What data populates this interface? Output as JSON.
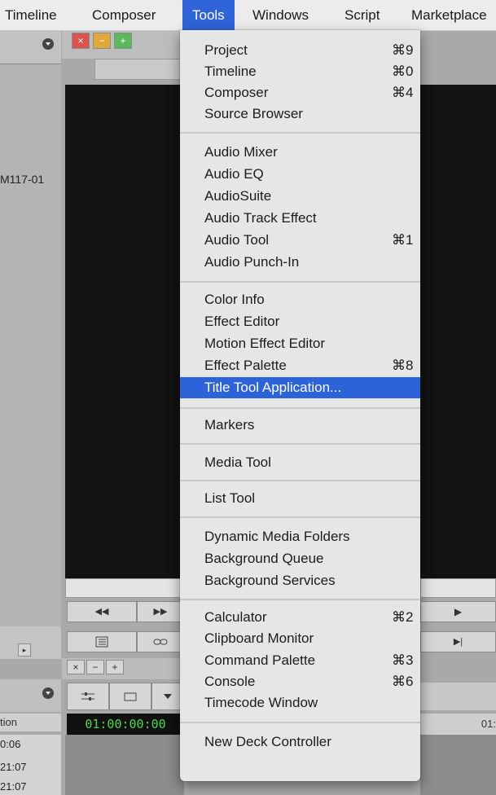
{
  "menubar": {
    "items": [
      {
        "label": "Timeline"
      },
      {
        "label": "Composer"
      },
      {
        "label": "Tools"
      },
      {
        "label": "Windows"
      },
      {
        "label": "Script"
      },
      {
        "label": "Marketplace"
      }
    ]
  },
  "background": {
    "bin_clip_name": "M117-01",
    "window_controls": {
      "close": "×",
      "minimize": "−",
      "zoom": "+"
    },
    "transport_rewind": "◀◀",
    "transport_forward": "▶▶",
    "transport_play": "▶",
    "transport_mark_out": "▶|",
    "timeline_column_label": "tion",
    "timecode": "01:00:00:00",
    "timecode_right": "01:",
    "row_times": [
      "0:06",
      "21:07",
      "21:07"
    ]
  },
  "menu": {
    "items": [
      {
        "label": "Project",
        "shortcut": "⌘9"
      },
      {
        "label": "Timeline",
        "shortcut": "⌘0"
      },
      {
        "label": "Composer",
        "shortcut": "⌘4"
      },
      {
        "label": "Source Browser",
        "shortcut": ""
      },
      {
        "label": "Audio Mixer",
        "shortcut": ""
      },
      {
        "label": "Audio EQ",
        "shortcut": ""
      },
      {
        "label": "AudioSuite",
        "shortcut": ""
      },
      {
        "label": "Audio Track Effect",
        "shortcut": ""
      },
      {
        "label": "Audio Tool",
        "shortcut": "⌘1"
      },
      {
        "label": "Audio Punch-In",
        "shortcut": ""
      },
      {
        "label": "Color Info",
        "shortcut": ""
      },
      {
        "label": "Effect Editor",
        "shortcut": ""
      },
      {
        "label": "Motion Effect Editor",
        "shortcut": ""
      },
      {
        "label": "Effect Palette",
        "shortcut": "⌘8"
      },
      {
        "label": "Title Tool Application...",
        "shortcut": ""
      },
      {
        "label": "Markers",
        "shortcut": ""
      },
      {
        "label": "Media Tool",
        "shortcut": ""
      },
      {
        "label": "List Tool",
        "shortcut": ""
      },
      {
        "label": "Dynamic Media Folders",
        "shortcut": ""
      },
      {
        "label": "Background Queue",
        "shortcut": ""
      },
      {
        "label": "Background Services",
        "shortcut": ""
      },
      {
        "label": "Calculator",
        "shortcut": "⌘2"
      },
      {
        "label": "Clipboard Monitor",
        "shortcut": ""
      },
      {
        "label": "Command Palette",
        "shortcut": "⌘3"
      },
      {
        "label": "Console",
        "shortcut": "⌘6"
      },
      {
        "label": "Timecode Window",
        "shortcut": ""
      },
      {
        "label": "New Deck Controller",
        "shortcut": ""
      }
    ],
    "highlighted_item": "Title Tool Application..."
  },
  "colors": {
    "menu_highlight": "#2c63d9",
    "timecode_text": "#4bd84b"
  }
}
